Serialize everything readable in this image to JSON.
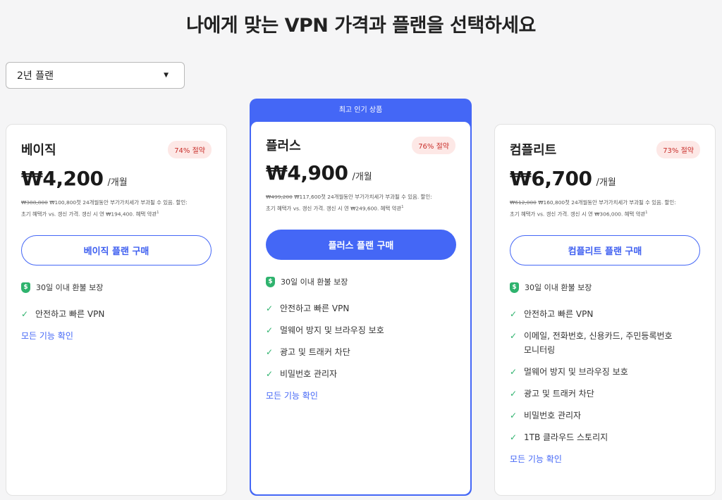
{
  "page": {
    "title": "나에게 맞는 VPN 가격과 플랜을 선택하세요"
  },
  "plan_select": {
    "value": "2년 플랜"
  },
  "plans": [
    {
      "name": "베이직",
      "save": "74% 절약",
      "price": "₩4,200",
      "per": "/개월",
      "orig_price": "₩388,800",
      "fine1": " ₩100,800첫 24개월동안 부가가치세가 부과될 수 있음. 할인:",
      "fine2": "초기 혜택가 vs. 갱신 가격. 갱신 시 연 ₩194,400. 혜택 약관",
      "fine_sup": "1",
      "button": "베이직 플랜 구매",
      "guarantee": "30일 이내 환불 보장",
      "features": [
        "안전하고 빠른 VPN"
      ],
      "all_features": "모든 기능 확인"
    },
    {
      "banner": "최고 인기 상품",
      "name": "플러스",
      "save": "76% 절약",
      "price": "₩4,900",
      "per": "/개월",
      "orig_price": "₩499,200",
      "fine1": " ₩117,600첫 24개월동안 부가가치세가 부과될 수 있음. 할인:",
      "fine2": "초기 혜택가 vs. 갱신 가격. 갱신 시 연 ₩249,600. 혜택 약관",
      "fine_sup": "1",
      "button": "플러스 플랜 구매",
      "guarantee": "30일 이내 환불 보장",
      "features": [
        "안전하고 빠른 VPN",
        "멀웨어 방지 및 브라우징 보호",
        "광고 및 트래커 차단",
        "비밀번호 관리자"
      ],
      "all_features": "모든 기능 확인"
    },
    {
      "name": "컴플리트",
      "save": "73% 절약",
      "price": "₩6,700",
      "per": "/개월",
      "orig_price": "₩612,000",
      "fine1": " ₩160,800첫 24개월동안 부가가치세가 부과될 수 있음. 할인:",
      "fine2": "초기 혜택가 vs. 갱신 가격. 갱신 시 연 ₩306,000. 혜택 약관",
      "fine_sup": "1",
      "button": "컴플리트 플랜 구매",
      "guarantee": "30일 이내 환불 보장",
      "features": [
        "안전하고 빠른 VPN",
        "이메일, 전화번호, 신용카드, 주민등록번호 모니터링",
        "멀웨어 방지 및 브라우징 보호",
        "광고 및 트래커 차단",
        "비밀번호 관리자",
        "1TB 클라우드 스토리지"
      ],
      "all_features": "모든 기능 확인"
    }
  ],
  "icons": {
    "check": "check-icon",
    "shield": "shield-dollar-icon",
    "caret": "caret-down-icon"
  },
  "colors": {
    "accent": "#4467f6",
    "check": "#2fb36e",
    "badge_bg": "#fde8e6",
    "badge_text": "#c9302c"
  }
}
